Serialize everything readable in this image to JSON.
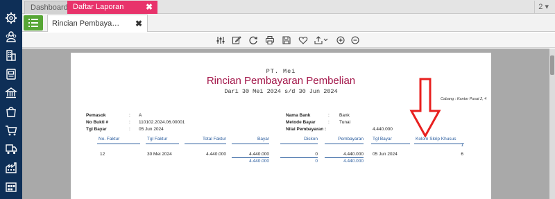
{
  "sidebar": {
    "icons": [
      "gear-icon",
      "people-icon",
      "building-icon",
      "document-list-icon",
      "bank-icon",
      "shopping-bag-icon",
      "cart-icon",
      "truck-icon",
      "factory-icon",
      "warehouse-icon"
    ]
  },
  "tabs": {
    "dashboard": "Dashboard",
    "daftar_laporan": "Daftar Laporan",
    "close_glyph": "✖",
    "page_indicator": "2"
  },
  "subtab": {
    "label": "Rincian Pembaya…",
    "close_glyph": "✖"
  },
  "toolbar": {
    "icons": [
      "settings-sliders-icon",
      "edit-icon",
      "refresh-icon",
      "print-icon",
      "save-icon",
      "favorite-heart-icon",
      "export-icon",
      "zoom-in-icon",
      "zoom-out-icon"
    ]
  },
  "report": {
    "company": "PT. Mei",
    "title": "Rincian Pembayaran Pembelian",
    "period": "Dari 30 Mei 2024 s/d 30 Jun 2024",
    "branch": "Cabang : Kantor Pusat 2, 4",
    "info_left": [
      {
        "label": "Pemasok",
        "sep": ":",
        "value": "A"
      },
      {
        "label": "No Bukti #",
        "sep": ":",
        "value": "110102.2024.06.00001"
      },
      {
        "label": "Tgl Bayar",
        "sep": ":",
        "value": "05 Jun 2024"
      }
    ],
    "info_right": [
      {
        "label": "Nama Bank",
        "sep": ":",
        "value": "Bank"
      },
      {
        "label": "Metode Bayar",
        "sep": ":",
        "value": "Tunai"
      },
      {
        "label": "Nilai Pembayaran :",
        "sep": "",
        "value": "4.440.000"
      }
    ],
    "columns": [
      "No. Faktur",
      "Tgl Faktur",
      "Total Faktur",
      "Bayar",
      "Diskon",
      "Pembayaran",
      "Tgl Bayar",
      "Kolom Skrip Khusus",
      "1"
    ],
    "row": {
      "no_faktur": "12",
      "tgl_faktur": "30 Mei 2024",
      "total_faktur": "4.440.000",
      "bayar": "4.440.000",
      "diskon": "0",
      "pembayaran": "4.440.000",
      "tgl_bayar": "05 Jun 2024",
      "kolom_skrip": "6"
    },
    "totals": {
      "bayar": "4.440.000",
      "diskon": "0",
      "pembayaran": "4.440.000"
    }
  },
  "annotation": {
    "arrow_color": "#e8201f"
  }
}
